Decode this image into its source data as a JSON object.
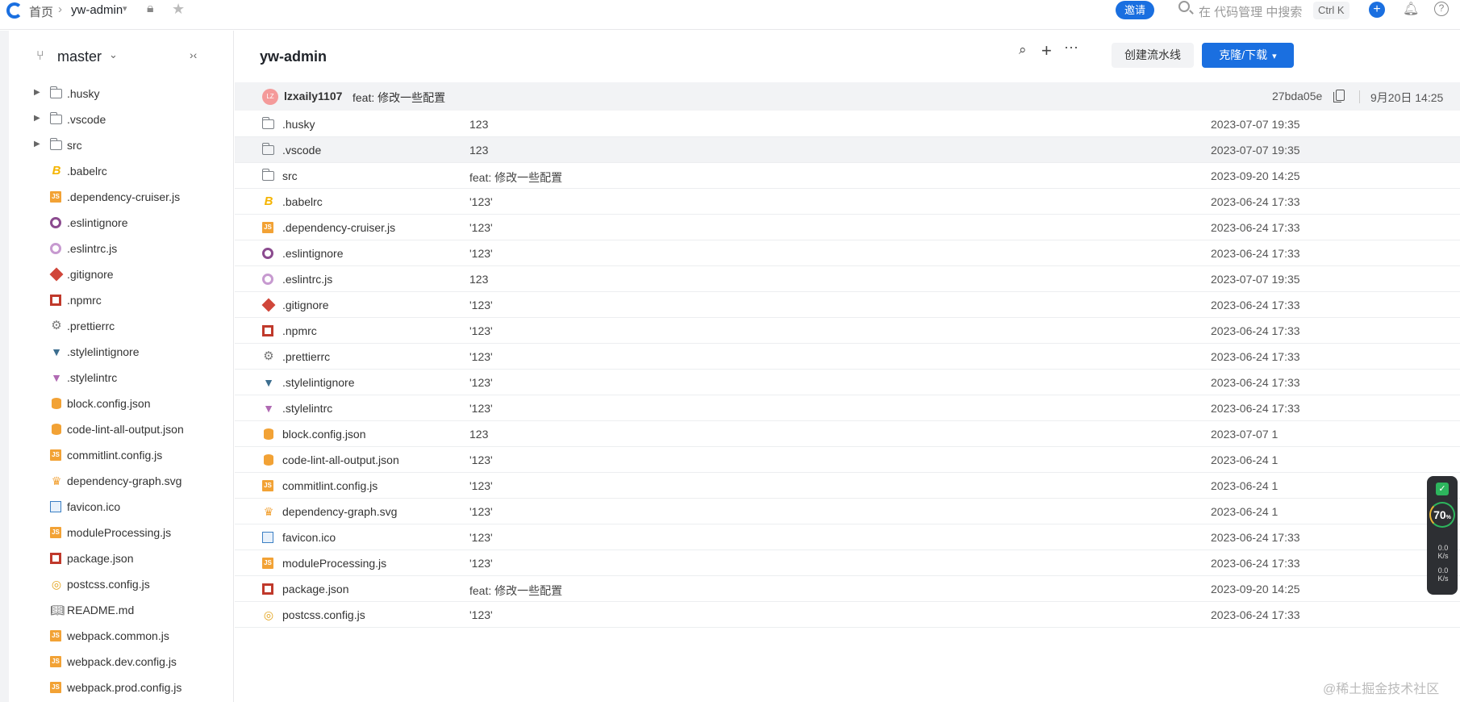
{
  "topbar": {
    "crumbs": [
      "首页",
      "yw-admin"
    ],
    "invite": "邀请",
    "search_placeholder": "在 代码管理 中搜索",
    "shortcut": "Ctrl K"
  },
  "sidebar": {
    "branch": "master",
    "items": [
      {
        "name": ".husky",
        "type": "folder"
      },
      {
        "name": ".vscode",
        "type": "folder"
      },
      {
        "name": "src",
        "type": "folder"
      },
      {
        "name": ".babelrc",
        "type": "babel-icon"
      },
      {
        "name": ".dependency-cruiser.js",
        "type": "js-icon"
      },
      {
        "name": ".eslintignore",
        "type": "eslint-icon"
      },
      {
        "name": ".eslintrc.js",
        "type": "eslint-icon"
      },
      {
        "name": ".gitignore",
        "type": "git-icon"
      },
      {
        "name": ".npmrc",
        "type": "npm-icon"
      },
      {
        "name": ".prettierrc",
        "type": "gear-icon"
      },
      {
        "name": ".stylelintignore",
        "type": "stylelint-icon"
      },
      {
        "name": ".stylelintrc",
        "type": "stylelint-icon"
      },
      {
        "name": "block.config.json",
        "type": "json-icon"
      },
      {
        "name": "code-lint-all-output.json",
        "type": "json-icon"
      },
      {
        "name": "commitlint.config.js",
        "type": "js-icon"
      },
      {
        "name": "dependency-graph.svg",
        "type": "svg-icon"
      },
      {
        "name": "favicon.ico",
        "type": "image-icon"
      },
      {
        "name": "moduleProcessing.js",
        "type": "js-icon"
      },
      {
        "name": "package.json",
        "type": "npm-icon"
      },
      {
        "name": "postcss.config.js",
        "type": "postcss-icon"
      },
      {
        "name": "README.md",
        "type": "book-icon"
      },
      {
        "name": "webpack.common.js",
        "type": "js-icon"
      },
      {
        "name": "webpack.dev.config.js",
        "type": "js-icon"
      },
      {
        "name": "webpack.prod.config.js",
        "type": "js-icon"
      }
    ]
  },
  "main": {
    "repo_title": "yw-admin",
    "create_pipeline": "创建流水线",
    "clone": "克隆/下载",
    "commit": {
      "avatar": "LZ",
      "author": "lzxaily1107",
      "message": "feat: 修改一些配置",
      "hash": "27bda05e",
      "date": "9月20日 14:25"
    },
    "files": [
      {
        "name": ".husky",
        "msg": "123",
        "date": "2023-07-07 19:35"
      },
      {
        "name": ".vscode",
        "msg": "123",
        "date": "2023-07-07 19:35"
      },
      {
        "name": "src",
        "msg": "feat: 修改一些配置",
        "date": "2023-09-20 14:25"
      },
      {
        "name": ".babelrc",
        "msg": "'123'",
        "date": "2023-06-24 17:33"
      },
      {
        "name": ".dependency-cruiser.js",
        "msg": "'123'",
        "date": "2023-06-24 17:33"
      },
      {
        "name": ".eslintignore",
        "msg": "'123'",
        "date": "2023-06-24 17:33"
      },
      {
        "name": ".eslintrc.js",
        "msg": "123",
        "date": "2023-07-07 19:35"
      },
      {
        "name": ".gitignore",
        "msg": "'123'",
        "date": "2023-06-24 17:33"
      },
      {
        "name": ".npmrc",
        "msg": "'123'",
        "date": "2023-06-24 17:33"
      },
      {
        "name": ".prettierrc",
        "msg": "'123'",
        "date": "2023-06-24 17:33"
      },
      {
        "name": ".stylelintignore",
        "msg": "'123'",
        "date": "2023-06-24 17:33"
      },
      {
        "name": ".stylelintrc",
        "msg": "'123'",
        "date": "2023-06-24 17:33"
      },
      {
        "name": "block.config.json",
        "msg": "123",
        "date": "2023-07-07 1"
      },
      {
        "name": "code-lint-all-output.json",
        "msg": "'123'",
        "date": "2023-06-24 1"
      },
      {
        "name": "commitlint.config.js",
        "msg": "'123'",
        "date": "2023-06-24 1"
      },
      {
        "name": "dependency-graph.svg",
        "msg": "'123'",
        "date": "2023-06-24 1"
      },
      {
        "name": "favicon.ico",
        "msg": "'123'",
        "date": "2023-06-24 17:33"
      },
      {
        "name": "moduleProcessing.js",
        "msg": "'123'",
        "date": "2023-06-24 17:33"
      },
      {
        "name": "package.json",
        "msg": "feat: 修改一些配置",
        "date": "2023-09-20 14:25"
      },
      {
        "name": "postcss.config.js",
        "msg": "'123'",
        "date": "2023-06-24 17:33"
      }
    ]
  },
  "widget": {
    "percent": "70",
    "unit": "%",
    "up": "0.0\nK/s",
    "down": "0.0\nK/s"
  },
  "watermark": "@稀土掘金技术社区"
}
